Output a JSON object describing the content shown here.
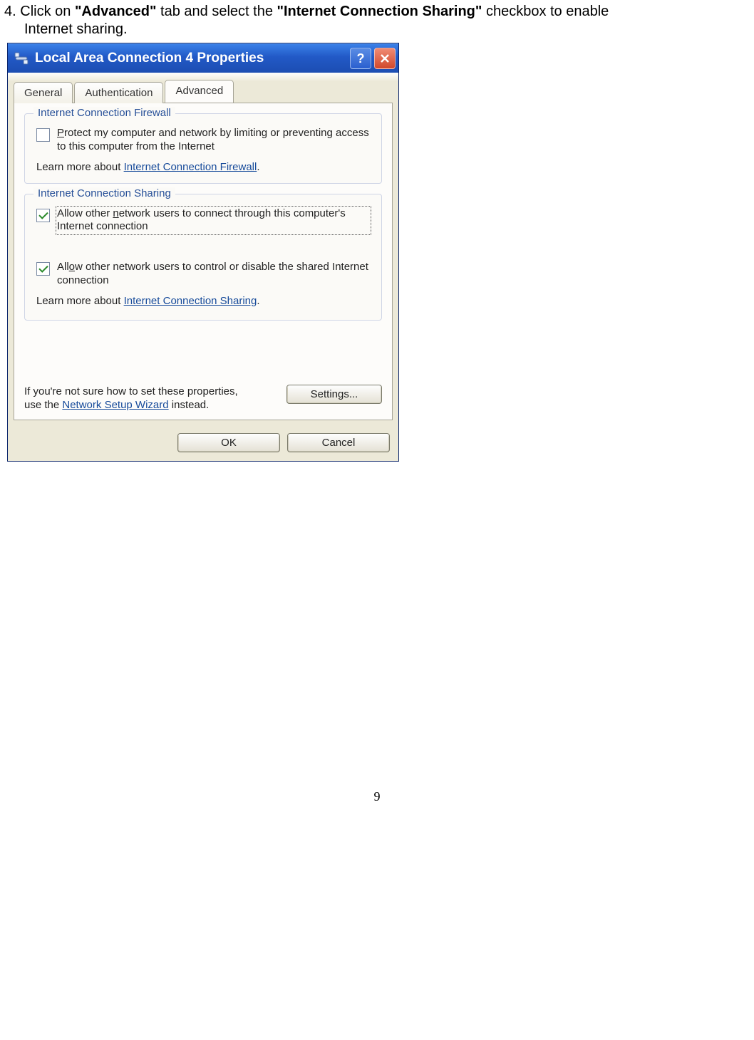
{
  "instruction": {
    "number": "4.",
    "pre": " Click on ",
    "bold1": "\"Advanced\"",
    "mid": " tab and select the ",
    "bold2": "\"Internet Connection Sharing\"",
    "post": " checkbox to enable",
    "line2": "Internet sharing."
  },
  "dialog": {
    "title": "Local Area Connection 4 Properties",
    "tabs": {
      "general": "General",
      "authentication": "Authentication",
      "advanced": "Advanced"
    },
    "firewall": {
      "title": "Internet Connection Firewall",
      "checkbox": "Protect my computer and network by limiting or preventing access to this computer from the Internet",
      "learn_pre": "Learn more about ",
      "learn_link": "Internet Connection Firewall",
      "learn_post": "."
    },
    "sharing": {
      "title": "Internet Connection Sharing",
      "checkbox1": "Allow other network users to connect through this computer's Internet connection",
      "checkbox2": "Allow other network users to control or disable the shared Internet connection",
      "learn_pre": "Learn more about ",
      "learn_link": "Internet Connection Sharing",
      "learn_post": "."
    },
    "bottom": {
      "text_pre": "If you're not sure how to set these properties, use the ",
      "wizard_link": "Network Setup Wizard",
      "text_post": " instead.",
      "settings_button": "Settings..."
    },
    "buttons": {
      "ok": "OK",
      "cancel": "Cancel"
    }
  },
  "page_number": "9"
}
